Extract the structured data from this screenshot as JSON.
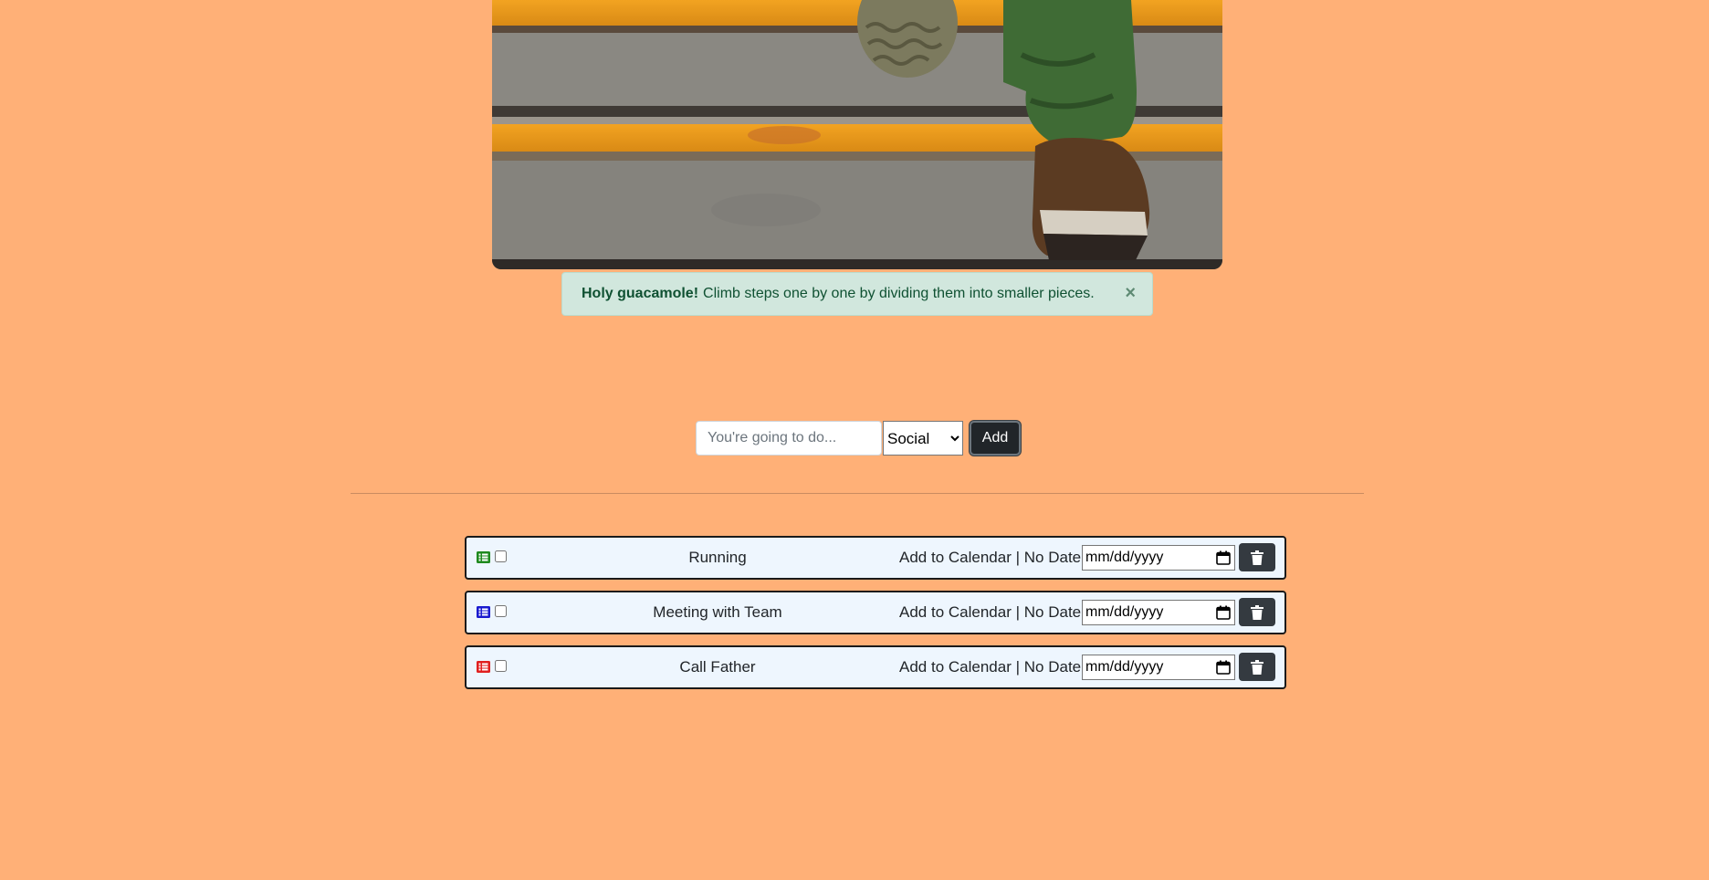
{
  "alert": {
    "strong": "Holy guacamole!",
    "message": "Climb steps one by one by dividing them into smaller pieces.",
    "close": "×"
  },
  "form": {
    "placeholder": "You're going to do...",
    "category_selected": "Social",
    "add_label": "Add"
  },
  "tasks": [
    {
      "name": "Running",
      "category_color": "#1F8A1F",
      "calendar_label": "Add to Calendar",
      "sep": "|",
      "date_status": "No Date",
      "date_placeholder": "mm/dd/yyyy"
    },
    {
      "name": "Meeting with Team",
      "category_color": "#1A1ACF",
      "calendar_label": "Add to Calendar",
      "sep": "|",
      "date_status": "No Date",
      "date_placeholder": "mm/dd/yyyy"
    },
    {
      "name": "Call Father",
      "category_color": "#E02020",
      "calendar_label": "Add to Calendar",
      "sep": "|",
      "date_status": "No Date",
      "date_placeholder": "mm/dd/yyyy"
    }
  ],
  "colors": {
    "background": "#FFB077",
    "alert_bg": "#D1E7DD",
    "alert_text": "#0F5132",
    "button_dark": "#212529",
    "row_bg": "#EEF6FE"
  }
}
